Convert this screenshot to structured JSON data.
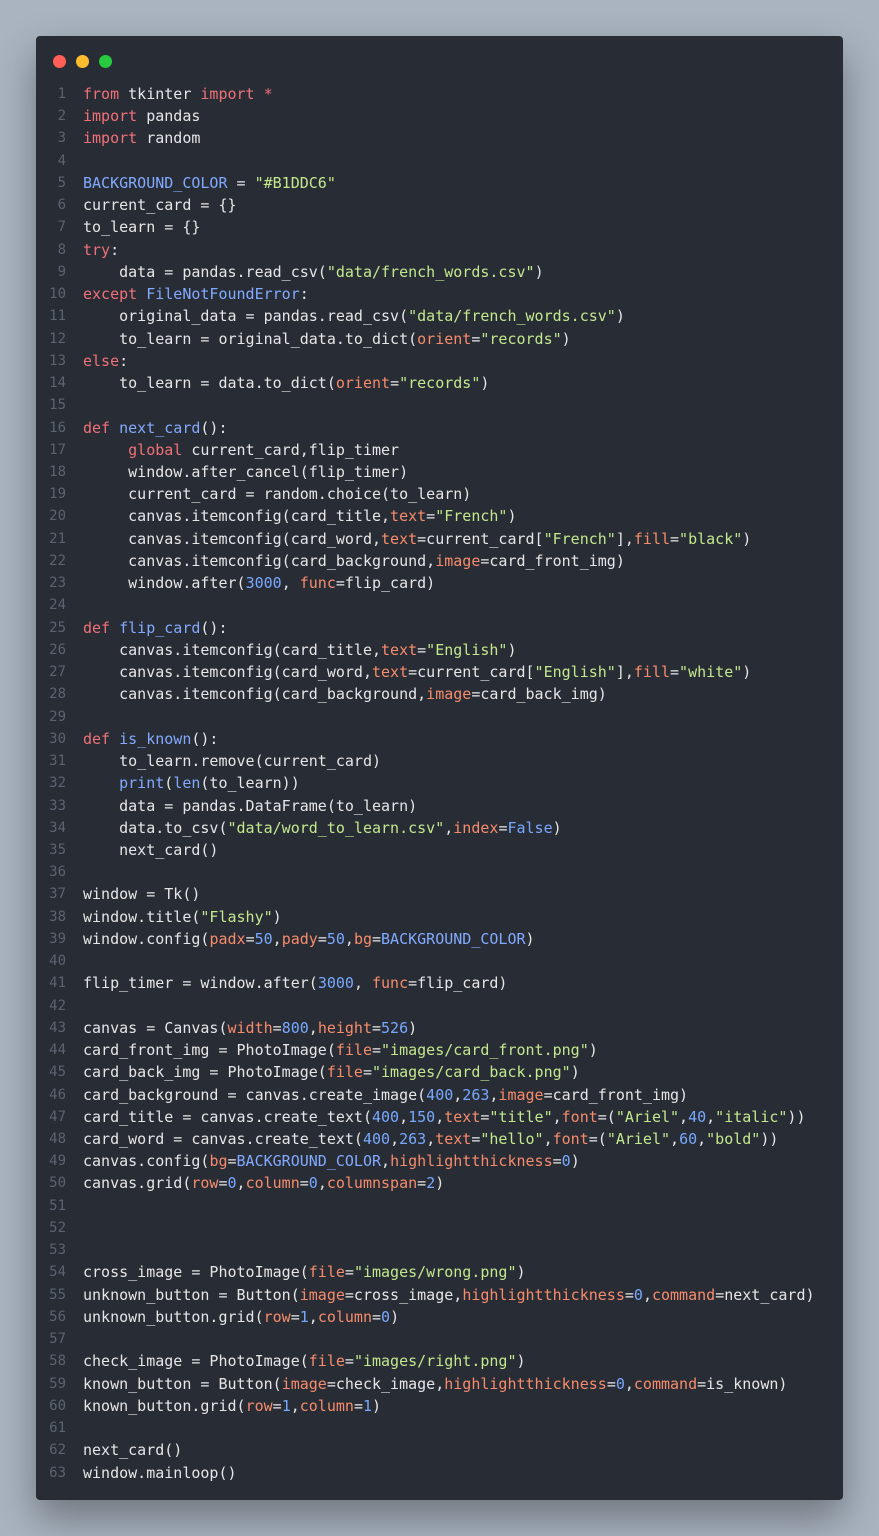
{
  "window": {
    "traffic_lights": [
      {
        "name": "close",
        "color": "#ff5f56"
      },
      {
        "name": "minimize",
        "color": "#ffbd2e"
      },
      {
        "name": "maximize",
        "color": "#27c93f"
      }
    ]
  },
  "code_lines": [
    [
      [
        "k",
        "from"
      ],
      [
        "pl",
        " tkinter "
      ],
      [
        "k",
        "import"
      ],
      [
        "pl",
        " "
      ],
      [
        "k",
        "*"
      ]
    ],
    [
      [
        "k",
        "import"
      ],
      [
        "pl",
        " pandas"
      ]
    ],
    [
      [
        "k",
        "import"
      ],
      [
        "pl",
        " random"
      ]
    ],
    [],
    [
      [
        "c",
        "BACKGROUND_COLOR"
      ],
      [
        "pl",
        " = "
      ],
      [
        "s",
        "\"#B1DDC6\""
      ]
    ],
    [
      [
        "pl",
        "current_card = {}"
      ]
    ],
    [
      [
        "pl",
        "to_learn = {}"
      ]
    ],
    [
      [
        "k",
        "try"
      ],
      [
        "pl",
        ":"
      ]
    ],
    [
      [
        "pl",
        "    data = pandas.read_csv("
      ],
      [
        "s",
        "\"data/french_words.csv\""
      ],
      [
        "pl",
        ")"
      ]
    ],
    [
      [
        "k",
        "except"
      ],
      [
        "pl",
        " "
      ],
      [
        "f",
        "FileNotFoundError"
      ],
      [
        "pl",
        ":"
      ]
    ],
    [
      [
        "pl",
        "    original_data = pandas.read_csv("
      ],
      [
        "s",
        "\"data/french_words.csv\""
      ],
      [
        "pl",
        ")"
      ]
    ],
    [
      [
        "pl",
        "    to_learn = original_data.to_dict("
      ],
      [
        "p",
        "orient"
      ],
      [
        "pl",
        "="
      ],
      [
        "s",
        "\"records\""
      ],
      [
        "pl",
        ")"
      ]
    ],
    [
      [
        "k",
        "else"
      ],
      [
        "pl",
        ":"
      ]
    ],
    [
      [
        "pl",
        "    to_learn = data.to_dict("
      ],
      [
        "p",
        "orient"
      ],
      [
        "pl",
        "="
      ],
      [
        "s",
        "\"records\""
      ],
      [
        "pl",
        ")"
      ]
    ],
    [],
    [
      [
        "k",
        "def"
      ],
      [
        "pl",
        " "
      ],
      [
        "f",
        "next_card"
      ],
      [
        "pl",
        "():"
      ]
    ],
    [
      [
        "pl",
        "     "
      ],
      [
        "k",
        "global"
      ],
      [
        "pl",
        " current_card,flip_timer"
      ]
    ],
    [
      [
        "pl",
        "     window.after_cancel(flip_timer)"
      ]
    ],
    [
      [
        "pl",
        "     current_card = random.choice(to_learn)"
      ]
    ],
    [
      [
        "pl",
        "     canvas.itemconfig(card_title,"
      ],
      [
        "p",
        "text"
      ],
      [
        "pl",
        "="
      ],
      [
        "s",
        "\"French\""
      ],
      [
        "pl",
        ")"
      ]
    ],
    [
      [
        "pl",
        "     canvas.itemconfig(card_word,"
      ],
      [
        "p",
        "text"
      ],
      [
        "pl",
        "=current_card["
      ],
      [
        "s",
        "\"French\""
      ],
      [
        "pl",
        "],"
      ],
      [
        "p",
        "fill"
      ],
      [
        "pl",
        "="
      ],
      [
        "s",
        "\"black\""
      ],
      [
        "pl",
        ")"
      ]
    ],
    [
      [
        "pl",
        "     canvas.itemconfig(card_background,"
      ],
      [
        "p",
        "image"
      ],
      [
        "pl",
        "=card_front_img)"
      ]
    ],
    [
      [
        "pl",
        "     window.after("
      ],
      [
        "n",
        "3000"
      ],
      [
        "pl",
        ", "
      ],
      [
        "p",
        "func"
      ],
      [
        "pl",
        "=flip_card)"
      ]
    ],
    [],
    [
      [
        "k",
        "def"
      ],
      [
        "pl",
        " "
      ],
      [
        "f",
        "flip_card"
      ],
      [
        "pl",
        "():"
      ]
    ],
    [
      [
        "pl",
        "    canvas.itemconfig(card_title,"
      ],
      [
        "p",
        "text"
      ],
      [
        "pl",
        "="
      ],
      [
        "s",
        "\"English\""
      ],
      [
        "pl",
        ")"
      ]
    ],
    [
      [
        "pl",
        "    canvas.itemconfig(card_word,"
      ],
      [
        "p",
        "text"
      ],
      [
        "pl",
        "=current_card["
      ],
      [
        "s",
        "\"English\""
      ],
      [
        "pl",
        "],"
      ],
      [
        "p",
        "fill"
      ],
      [
        "pl",
        "="
      ],
      [
        "s",
        "\"white\""
      ],
      [
        "pl",
        ")"
      ]
    ],
    [
      [
        "pl",
        "    canvas.itemconfig(card_background,"
      ],
      [
        "p",
        "image"
      ],
      [
        "pl",
        "=card_back_img)"
      ]
    ],
    [],
    [
      [
        "k",
        "def"
      ],
      [
        "pl",
        " "
      ],
      [
        "f",
        "is_known"
      ],
      [
        "pl",
        "():"
      ]
    ],
    [
      [
        "pl",
        "    to_learn.remove(current_card)"
      ]
    ],
    [
      [
        "pl",
        "    "
      ],
      [
        "f",
        "print"
      ],
      [
        "pl",
        "("
      ],
      [
        "f",
        "len"
      ],
      [
        "pl",
        "(to_learn))"
      ]
    ],
    [
      [
        "pl",
        "    data = pandas.DataFrame(to_learn)"
      ]
    ],
    [
      [
        "pl",
        "    data.to_csv("
      ],
      [
        "s",
        "\"data/word_to_learn.csv\""
      ],
      [
        "pl",
        ","
      ],
      [
        "p",
        "index"
      ],
      [
        "pl",
        "="
      ],
      [
        "n",
        "False"
      ],
      [
        "pl",
        ")"
      ]
    ],
    [
      [
        "pl",
        "    next_card()"
      ]
    ],
    [],
    [
      [
        "pl",
        "window = Tk()"
      ]
    ],
    [
      [
        "pl",
        "window.title("
      ],
      [
        "s",
        "\"Flashy\""
      ],
      [
        "pl",
        ")"
      ]
    ],
    [
      [
        "pl",
        "window.config("
      ],
      [
        "p",
        "padx"
      ],
      [
        "pl",
        "="
      ],
      [
        "n",
        "50"
      ],
      [
        "pl",
        ","
      ],
      [
        "p",
        "pady"
      ],
      [
        "pl",
        "="
      ],
      [
        "n",
        "50"
      ],
      [
        "pl",
        ","
      ],
      [
        "p",
        "bg"
      ],
      [
        "pl",
        "="
      ],
      [
        "c",
        "BACKGROUND_COLOR"
      ],
      [
        "pl",
        ")"
      ]
    ],
    [],
    [
      [
        "pl",
        "flip_timer = window.after("
      ],
      [
        "n",
        "3000"
      ],
      [
        "pl",
        ", "
      ],
      [
        "p",
        "func"
      ],
      [
        "pl",
        "=flip_card)"
      ]
    ],
    [],
    [
      [
        "pl",
        "canvas = Canvas("
      ],
      [
        "p",
        "width"
      ],
      [
        "pl",
        "="
      ],
      [
        "n",
        "800"
      ],
      [
        "pl",
        ","
      ],
      [
        "p",
        "height"
      ],
      [
        "pl",
        "="
      ],
      [
        "n",
        "526"
      ],
      [
        "pl",
        ")"
      ]
    ],
    [
      [
        "pl",
        "card_front_img = PhotoImage("
      ],
      [
        "p",
        "file"
      ],
      [
        "pl",
        "="
      ],
      [
        "s",
        "\"images/card_front.png\""
      ],
      [
        "pl",
        ")"
      ]
    ],
    [
      [
        "pl",
        "card_back_img = PhotoImage("
      ],
      [
        "p",
        "file"
      ],
      [
        "pl",
        "="
      ],
      [
        "s",
        "\"images/card_back.png\""
      ],
      [
        "pl",
        ")"
      ]
    ],
    [
      [
        "pl",
        "card_background = canvas.create_image("
      ],
      [
        "n",
        "400"
      ],
      [
        "pl",
        ","
      ],
      [
        "n",
        "263"
      ],
      [
        "pl",
        ","
      ],
      [
        "p",
        "image"
      ],
      [
        "pl",
        "=card_front_img)"
      ]
    ],
    [
      [
        "pl",
        "card_title = canvas.create_text("
      ],
      [
        "n",
        "400"
      ],
      [
        "pl",
        ","
      ],
      [
        "n",
        "150"
      ],
      [
        "pl",
        ","
      ],
      [
        "p",
        "text"
      ],
      [
        "pl",
        "="
      ],
      [
        "s",
        "\"title\""
      ],
      [
        "pl",
        ","
      ],
      [
        "p",
        "font"
      ],
      [
        "pl",
        "=("
      ],
      [
        "s",
        "\"Ariel\""
      ],
      [
        "pl",
        ","
      ],
      [
        "n",
        "40"
      ],
      [
        "pl",
        ","
      ],
      [
        "s",
        "\"italic\""
      ],
      [
        "pl",
        "))"
      ]
    ],
    [
      [
        "pl",
        "card_word = canvas.create_text("
      ],
      [
        "n",
        "400"
      ],
      [
        "pl",
        ","
      ],
      [
        "n",
        "263"
      ],
      [
        "pl",
        ","
      ],
      [
        "p",
        "text"
      ],
      [
        "pl",
        "="
      ],
      [
        "s",
        "\"hello\""
      ],
      [
        "pl",
        ","
      ],
      [
        "p",
        "font"
      ],
      [
        "pl",
        "=("
      ],
      [
        "s",
        "\"Ariel\""
      ],
      [
        "pl",
        ","
      ],
      [
        "n",
        "60"
      ],
      [
        "pl",
        ","
      ],
      [
        "s",
        "\"bold\""
      ],
      [
        "pl",
        "))"
      ]
    ],
    [
      [
        "pl",
        "canvas.config("
      ],
      [
        "p",
        "bg"
      ],
      [
        "pl",
        "="
      ],
      [
        "c",
        "BACKGROUND_COLOR"
      ],
      [
        "pl",
        ","
      ],
      [
        "p",
        "highlightthickness"
      ],
      [
        "pl",
        "="
      ],
      [
        "n",
        "0"
      ],
      [
        "pl",
        ")"
      ]
    ],
    [
      [
        "pl",
        "canvas.grid("
      ],
      [
        "p",
        "row"
      ],
      [
        "pl",
        "="
      ],
      [
        "n",
        "0"
      ],
      [
        "pl",
        ","
      ],
      [
        "p",
        "column"
      ],
      [
        "pl",
        "="
      ],
      [
        "n",
        "0"
      ],
      [
        "pl",
        ","
      ],
      [
        "p",
        "columnspan"
      ],
      [
        "pl",
        "="
      ],
      [
        "n",
        "2"
      ],
      [
        "pl",
        ")"
      ]
    ],
    [],
    [],
    [],
    [
      [
        "pl",
        "cross_image = PhotoImage("
      ],
      [
        "p",
        "file"
      ],
      [
        "pl",
        "="
      ],
      [
        "s",
        "\"images/wrong.png\""
      ],
      [
        "pl",
        ")"
      ]
    ],
    [
      [
        "pl",
        "unknown_button = Button("
      ],
      [
        "p",
        "image"
      ],
      [
        "pl",
        "=cross_image,"
      ],
      [
        "p",
        "highlightthickness"
      ],
      [
        "pl",
        "="
      ],
      [
        "n",
        "0"
      ],
      [
        "pl",
        ","
      ],
      [
        "p",
        "command"
      ],
      [
        "pl",
        "=next_card)"
      ]
    ],
    [
      [
        "pl",
        "unknown_button.grid("
      ],
      [
        "p",
        "row"
      ],
      [
        "pl",
        "="
      ],
      [
        "n",
        "1"
      ],
      [
        "pl",
        ","
      ],
      [
        "p",
        "column"
      ],
      [
        "pl",
        "="
      ],
      [
        "n",
        "0"
      ],
      [
        "pl",
        ")"
      ]
    ],
    [],
    [
      [
        "pl",
        "check_image = PhotoImage("
      ],
      [
        "p",
        "file"
      ],
      [
        "pl",
        "="
      ],
      [
        "s",
        "\"images/right.png\""
      ],
      [
        "pl",
        ")"
      ]
    ],
    [
      [
        "pl",
        "known_button = Button("
      ],
      [
        "p",
        "image"
      ],
      [
        "pl",
        "=check_image,"
      ],
      [
        "p",
        "highlightthickness"
      ],
      [
        "pl",
        "="
      ],
      [
        "n",
        "0"
      ],
      [
        "pl",
        ","
      ],
      [
        "p",
        "command"
      ],
      [
        "pl",
        "=is_known)"
      ]
    ],
    [
      [
        "pl",
        "known_button.grid("
      ],
      [
        "p",
        "row"
      ],
      [
        "pl",
        "="
      ],
      [
        "n",
        "1"
      ],
      [
        "pl",
        ","
      ],
      [
        "p",
        "column"
      ],
      [
        "pl",
        "="
      ],
      [
        "n",
        "1"
      ],
      [
        "pl",
        ")"
      ]
    ],
    [],
    [
      [
        "pl",
        "next_card()"
      ]
    ],
    [
      [
        "pl",
        "window.mainloop()"
      ]
    ]
  ]
}
